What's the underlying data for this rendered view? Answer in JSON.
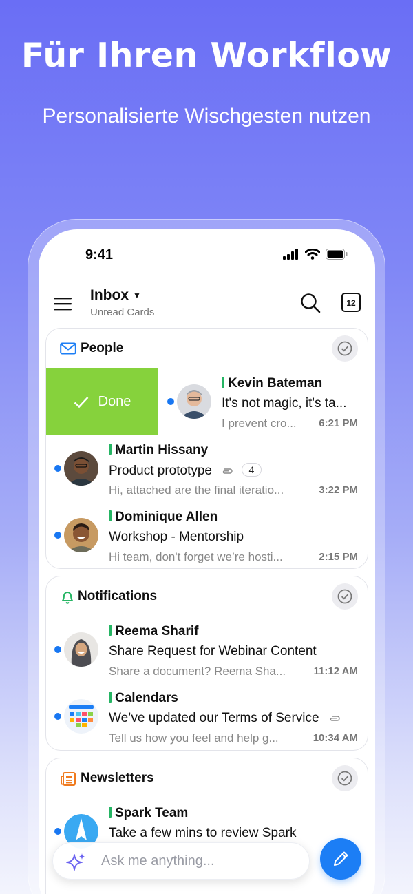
{
  "promo": {
    "title": "Für Ihren Workflow",
    "subtitle": "Personalisierte Wischgesten nutzen"
  },
  "status_bar": {
    "time": "9:41",
    "icons": [
      "signal-icon",
      "wifi-icon",
      "battery-icon"
    ]
  },
  "header": {
    "title": "Inbox",
    "subtitle": "Unread Cards",
    "calendar_day": "12"
  },
  "people": {
    "title": "People",
    "swipe_action": "Done",
    "rows": [
      {
        "sender": "Kevin Bateman",
        "subject": "It's not magic, it's ta...",
        "preview": "I prevent cro...",
        "time": "6:21 PM"
      },
      {
        "sender": "Martin Hissany",
        "subject": "Product prototype",
        "attachment_count": "4",
        "preview": "Hi, attached are the final iteratio...",
        "time": "3:22 PM"
      },
      {
        "sender": "Dominique Allen",
        "subject": "Workshop - Mentorship",
        "preview": "Hi team, don't forget we’re hosti...",
        "time": "2:15 PM"
      }
    ]
  },
  "notifications": {
    "title": "Notifications",
    "rows": [
      {
        "sender": "Reema Sharif",
        "subject": "Share Request for Webinar Content",
        "preview": "Share a document? Reema Sha...",
        "time": "11:12 AM"
      },
      {
        "sender": "Calendars",
        "subject": "We’ve updated our Terms of Service",
        "preview": "Tell us how you feel and help g...",
        "time": "10:34 AM"
      }
    ]
  },
  "newsletters": {
    "title": "Newsletters",
    "rows": [
      {
        "sender": "Spark Team",
        "subject": "Take a few mins to review Spark"
      }
    ]
  },
  "ask_bar": {
    "placeholder": "Ask me anything..."
  },
  "colors": {
    "accent": "#1c7ef5",
    "done_green": "#86d23c",
    "unread_dot": "#1877f2",
    "sender_bar": "#26b564"
  }
}
